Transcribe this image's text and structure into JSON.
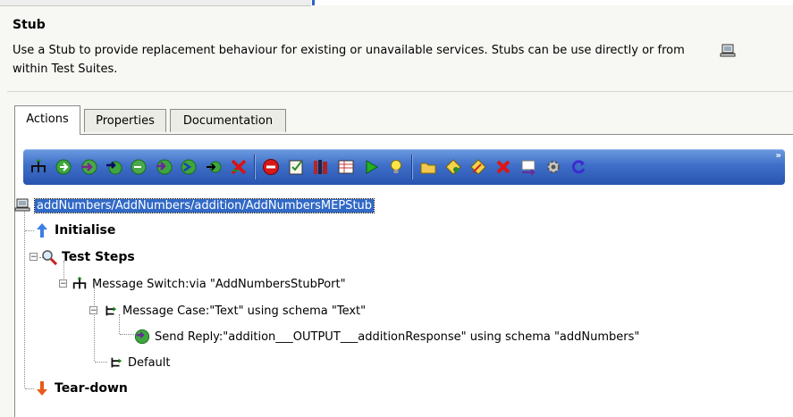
{
  "header": {
    "title": "Stub",
    "description": "Use a Stub to provide replacement behaviour for existing or unavailable services.  Stubs can be use directly or from within Test Suites.",
    "icon": "computer-icon"
  },
  "tabs": [
    {
      "label": "Actions",
      "active": true
    },
    {
      "label": "Properties",
      "active": false
    },
    {
      "label": "Documentation",
      "active": false
    }
  ],
  "toolbar": {
    "buttons": [
      "message-switch-icon",
      "green-arrow-icon",
      "green-arrow-in-icon",
      "green-arrow-out-icon",
      "green-arrow-back-icon",
      "green-arrow-reply-icon",
      "green-arrow-right-icon",
      "remove-arrow-icon",
      "stop-icon",
      "checklist-icon",
      "books-icon",
      "data-table-icon",
      "run-icon",
      "lightbulb-icon",
      "folder-icon",
      "diamond-decision-icon",
      "diamond-tool-icon",
      "red-x-icon",
      "grid-arrow-icon",
      "cog-refresh-icon",
      "refresh-icon"
    ]
  },
  "tree": {
    "root": "addNumbers/AddNumbers/addition/AddNumbersMEPStub",
    "initialise": "Initialise",
    "test_steps": "Test Steps",
    "message_switch": "Message Switch:via \"AddNumbersStubPort\"",
    "message_case": "Message Case:\"Text\" using schema \"Text\"",
    "send_reply": "Send Reply:\"addition___OUTPUT___additionResponse\" using schema \"addNumbers\"",
    "default": "Default",
    "tear_down": "Tear-down"
  },
  "colors": {
    "toolbar_top": "#6d9be0",
    "toolbar_bottom": "#2954b0",
    "selection": "#3169c6"
  }
}
